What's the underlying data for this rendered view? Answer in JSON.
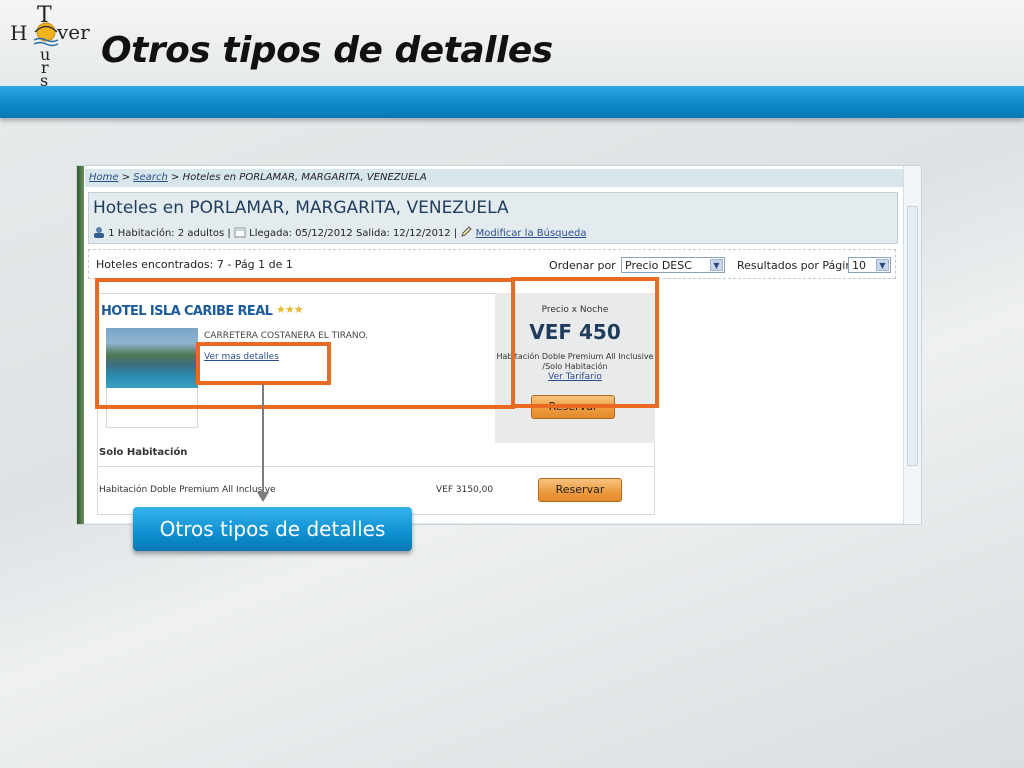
{
  "slide": {
    "title": "Otros tipos de detalles",
    "logo_text": "HoverTours",
    "colors": {
      "accent_band": "#0b86c9",
      "annotation": "#ea6a24",
      "callout": "#1a9ad8"
    }
  },
  "screenshot": {
    "breadcrumb": {
      "home": "Home",
      "sep1": " > ",
      "search": "Search",
      "current": " > Hoteles en PORLAMAR, MARGARITA, VENEZUELA"
    },
    "header": {
      "title": "Hoteles en PORLAMAR, MARGARITA, VENEZUELA",
      "rooms": "1 Habitación: 2 adultos |",
      "dates": "Llegada: 05/12/2012 Salida: 12/12/2012 |",
      "modify_link": "Modificar la Búsqueda"
    },
    "results": {
      "found": "Hoteles encontrados: 7 - Pág 1 de 1",
      "order_label": "Ordenar por",
      "order_value": "Precio DESC",
      "per_page_label": "Resultados por Página",
      "per_page_value": "10"
    },
    "hotel": {
      "name": "HOTEL ISLA CARIBE REAL",
      "stars": "★★★",
      "address": "CARRETERA COSTANERA EL TIRANO.",
      "more_link": "Ver mas detalles",
      "price_label": "Precio x Noche",
      "price": "VEF  450",
      "room_desc": "Habitación Doble Premium All Inclusive /Solo Habitación",
      "tariff_link": "Ver Tarifario",
      "reserve_label": "Reservar"
    },
    "rooms": {
      "type_label": "Solo Habitación",
      "room_name": "Habitación Doble Premium All Inclusive",
      "room_price": "VEF  3150,00",
      "reserve_label": "Reservar"
    }
  },
  "callout": {
    "text": "Otros tipos de detalles"
  }
}
